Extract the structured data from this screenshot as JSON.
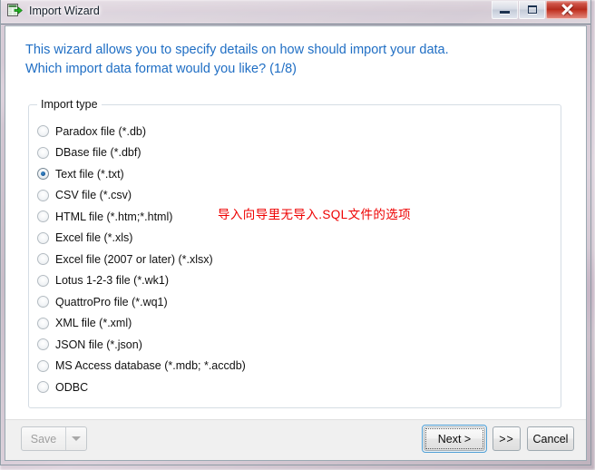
{
  "window": {
    "title": "Import Wizard",
    "icon": "import-table-icon",
    "controls": {
      "minimize": "minimize-icon",
      "maximize": "maximize-icon",
      "close": "close-icon"
    }
  },
  "header": {
    "text": "This wizard allows you to specify details on how should import your data.\nWhich import data format would you like? (1/8)",
    "color": "#1f6ec4",
    "step": "1/8"
  },
  "group": {
    "label": "Import type",
    "selected_index": 2,
    "options": [
      {
        "label": "Paradox file (*.db)"
      },
      {
        "label": "DBase file (*.dbf)"
      },
      {
        "label": "Text file (*.txt)"
      },
      {
        "label": "CSV file (*.csv)"
      },
      {
        "label": "HTML file (*.htm;*.html)"
      },
      {
        "label": "Excel file (*.xls)"
      },
      {
        "label": "Excel file (2007 or later) (*.xlsx)"
      },
      {
        "label": "Lotus 1-2-3 file (*.wk1)"
      },
      {
        "label": "QuattroPro file (*.wq1)"
      },
      {
        "label": "XML file (*.xml)"
      },
      {
        "label": "JSON file (*.json)"
      },
      {
        "label": "MS Access database (*.mdb; *.accdb)"
      },
      {
        "label": "ODBC"
      }
    ]
  },
  "annotation": {
    "text": "导入向导里无导入.SQL文件的选项",
    "color": "#ee0000"
  },
  "footer": {
    "save_label": "Save",
    "save_dropdown_icon": "chevron-down-icon",
    "next_label": "Next >",
    "more_label": ">>",
    "cancel_label": "Cancel"
  }
}
